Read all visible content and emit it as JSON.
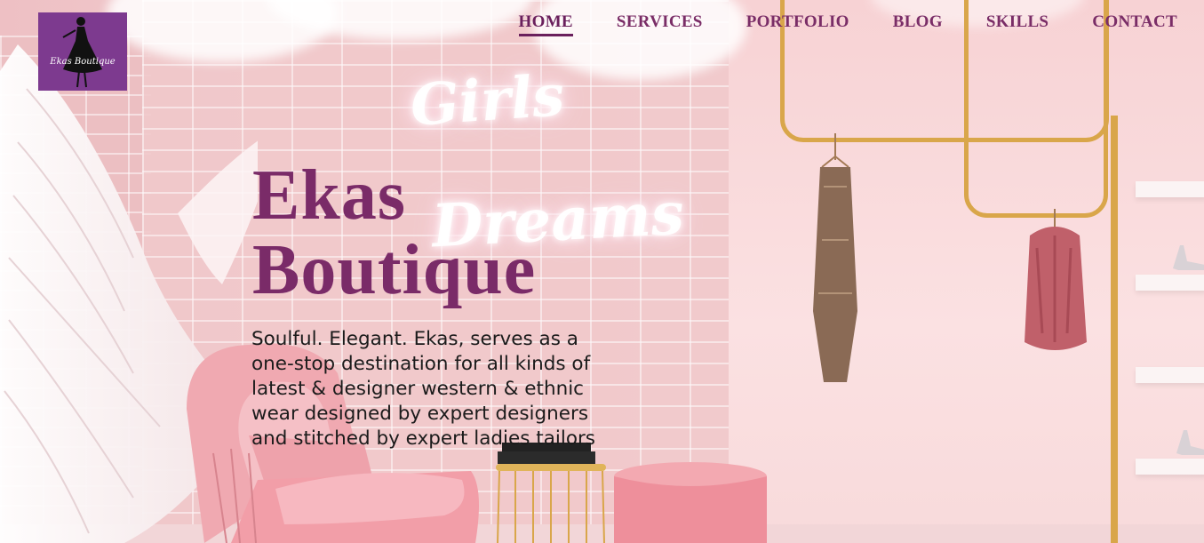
{
  "brand": {
    "logo_alt": "Ekas Boutique",
    "logo_text": "Ekas Boutique"
  },
  "nav": {
    "items": [
      {
        "label": "HOME",
        "active": true
      },
      {
        "label": "SERVICES",
        "active": false
      },
      {
        "label": "PORTFOLIO",
        "active": false
      },
      {
        "label": "BLOG",
        "active": false
      },
      {
        "label": "SKILLS",
        "active": false
      },
      {
        "label": "CONTACT",
        "active": false
      }
    ]
  },
  "hero": {
    "title_line1": "Ekas",
    "title_line2": "Boutique",
    "tagline": "Soulful. Elegant. Ekas, serves as a one-stop destination for all kinds of latest & designer western & ethnic wear designed by expert designers and stitched by expert ladies tailors",
    "neon_sign": {
      "line1": "Girls",
      "line2": "Dreams"
    }
  },
  "colors": {
    "brand_purple": "#7d3a8f",
    "title": "#7a2b68",
    "nav": "#7a2d67",
    "gold": "#d9a64a"
  }
}
